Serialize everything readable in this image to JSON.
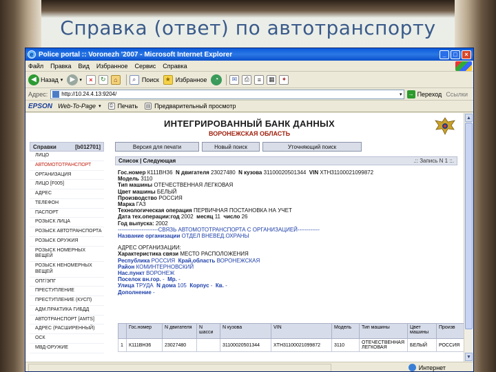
{
  "slide": {
    "title": "Справка (ответ) по автотранспорту"
  },
  "window": {
    "title": "Police portal :: Voronezh '2007 - Microsoft Internet Explorer",
    "menu": [
      "Файл",
      "Правка",
      "Вид",
      "Избранное",
      "Сервис",
      "Справка"
    ],
    "toolbar": {
      "back": "Назад",
      "search": "Поиск",
      "favorites": "Избранное"
    },
    "address": {
      "label": "Адрес:",
      "url": "http://10.24.4.13:9204/",
      "go": "Переход",
      "links": "Ссылки"
    },
    "epson": {
      "brand": "EPSON",
      "web_to_page": "Web-To-Page",
      "print": "Печать",
      "preview": "Предварительный просмотр"
    },
    "status": {
      "zone": "Интернет"
    }
  },
  "page": {
    "db_title": "ИНТЕГРИРОВАННЫЙ БАНК ДАННЫХ",
    "db_region": "ВОРОНЕЖСКАЯ ОБЛАСТЬ",
    "sidebar": {
      "head_left": "Справки",
      "head_right": "[b012701]",
      "items": [
        "ЛИЦО",
        "АВТОМОТОТРАНСПОРТ",
        "ОРГАНИЗАЦИЯ",
        "ЛИЦО [F005]",
        "АДРЕС",
        "ТЕЛЕФОН",
        "ПАСПОРТ",
        "РОЗЫСК ЛИЦА",
        "РОЗЫСК АВТОТРАНСПОРТА",
        "РОЗЫСК ОРУЖИЯ",
        "РОЗЫСК НОМЕРНЫХ ВЕЩЕЙ",
        "РОЗЫСК НЕНОМЕРНЫХ ВЕЩЕЙ",
        "ОПГ/ЭПГ",
        "ПРЕСТУПЛЕНИЕ",
        "ПРЕСТУПЛЕНИЕ (КУСП)",
        "АДМ.ПРАКТИКА ГИБДД",
        "АВТОТРАНСПОРТ [AMTS]",
        "АДРЕС (РАСШИРЕННЫЙ)",
        "ОСК",
        "МВД-ОРУЖИЕ"
      ]
    },
    "buttons": {
      "print_version": "Версия для печати",
      "new_search": "Новый поиск",
      "refine_search": "Уточняющий поиск"
    },
    "listbar": {
      "left": "Список | Следующая",
      "right": ".:: Запись N 1 ::."
    },
    "record": {
      "gos_label": "Гос.номер",
      "gos": "К111ВН36",
      "engine_label": "N двигателя",
      "engine": "23027480",
      "body_label": "N кузова",
      "body": "31100020501344",
      "vin_label": "VIN",
      "vin": "ХТН31100021099872",
      "model_label": "Модель",
      "model": "3110",
      "type_label": "Тип машины",
      "type": "ОТЕЧЕСТВЕННАЯ ЛЕГКОВАЯ",
      "color_label": "Цвет машины",
      "color": "БЕЛЫЙ",
      "prod_label": "Производство",
      "prod": "РОССИЯ",
      "brand_label": "Марка",
      "brand": "ГАЗ",
      "op_label": "Технологическая операция",
      "op": "ПЕРВИЧНАЯ ПОСТАНОВКА НА УЧЕТ",
      "opdate_label": "Дата тех.операции:год",
      "op_year": "2002",
      "month_label": "месяц",
      "op_month": "11",
      "day_label": "число",
      "op_day": "26",
      "year_label": "Год выпуска:",
      "year": "2002",
      "link_line": "----------------------СВЯЗЬ АВТОМОТОТРАНСПОРТА С ОРГАНИЗАЦИЕЙ------------",
      "org_label": "Название организации",
      "org": "ОТДЕЛ ВНЕВЕД.ОХРАНЫ",
      "addr_head": "АДРЕС ОРГАНИЗАЦИИ:",
      "link_char_label": "Характеристика связи",
      "link_char": "МЕСТО РАСПОЛОЖЕНИЯ",
      "rep_label": "Республика",
      "rep": "РОССИЯ",
      "reg_label": "Край,область",
      "reg": "ВОРОНЕЖСКАЯ",
      "dist_label": "Район",
      "dist": "КОМИНТЕРНОВСКИЙ",
      "city_label": "Нас.пункт",
      "city": "ВОРОНЕЖ",
      "settl_label": "Поселок вн.гор.",
      "settl": "-",
      "mkr_label": "Мр.",
      "mkr": "-",
      "street_label": "Улица",
      "street": "ТРУДА",
      "house_label": "N дома",
      "house": "105",
      "korp_label": "Корпус",
      "korp": "-",
      "kv_label": "Кв.",
      "kv": "-",
      "extra_label": "Дополнение",
      "extra": "-"
    },
    "table": {
      "headers": [
        "",
        "Гос.номер",
        "N двигателя",
        "N шасси",
        "N кузова",
        "VIN",
        "Модель",
        "Тип машины",
        "Цвет машины",
        "Произв"
      ],
      "rows": [
        [
          "1",
          "К111ВН36",
          "23027480",
          "",
          "31100020501344",
          "ХТН31100021099872",
          "3110",
          "ОТЕЧЕСТВЕННАЯ ЛЕГКОВАЯ",
          "БЕЛЫЙ",
          "РОССИЯ"
        ]
      ]
    }
  }
}
